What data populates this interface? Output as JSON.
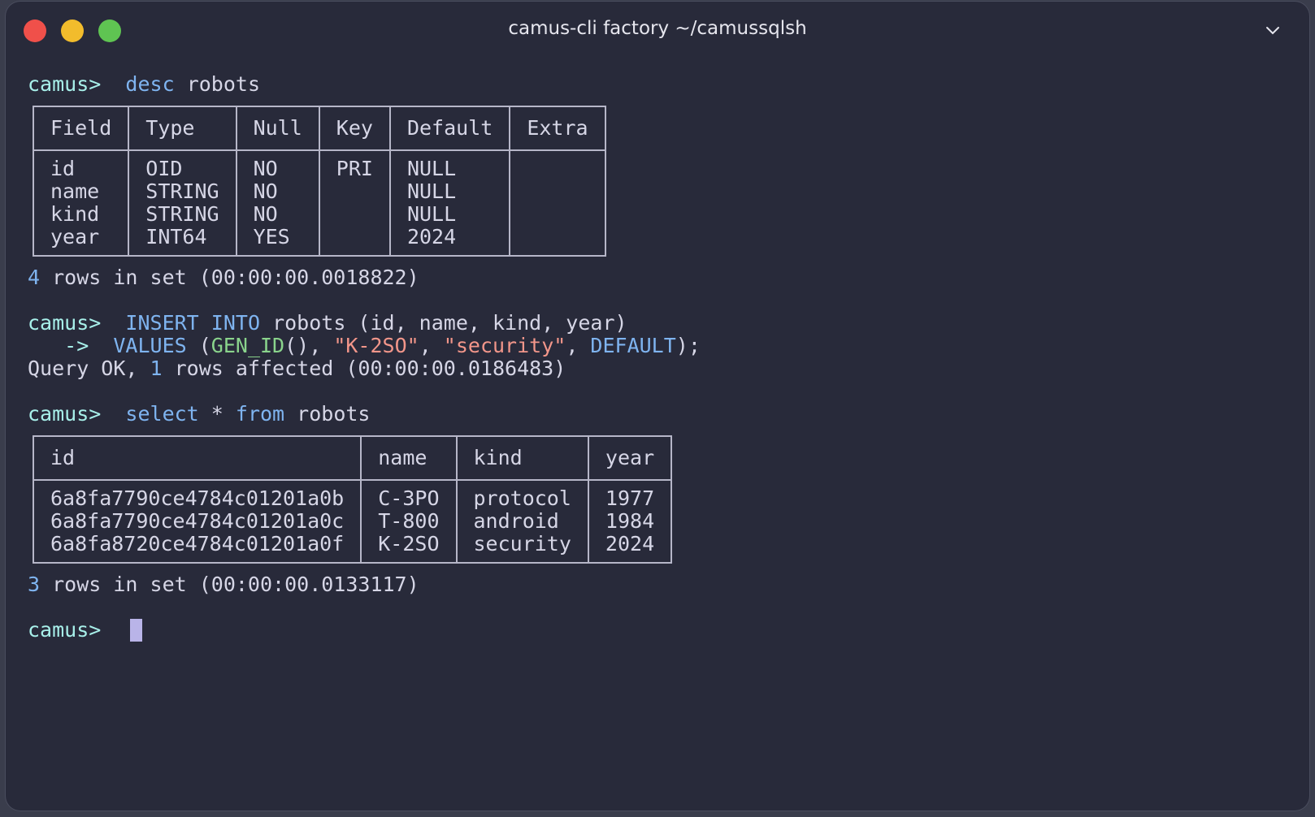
{
  "window": {
    "title": "camus-cli factory ~/camussqlsh"
  },
  "prompt": "camus>",
  "cont_prompt": "   ->",
  "colors": {
    "prompt": "#a8f0ea",
    "keyword": "#7fb4f0",
    "function": "#8ad48c",
    "string": "#f2968a",
    "background": "#282a3a"
  },
  "icons": {
    "close": "close-traffic-light",
    "minimize": "minimize-traffic-light",
    "zoom": "zoom-traffic-light",
    "menu": "chevron-down-icon"
  },
  "cmd1": {
    "kw": "desc",
    "rest": " robots"
  },
  "desc_table": {
    "headers": [
      "Field",
      "Type",
      "Null",
      "Key",
      "Default",
      "Extra"
    ],
    "columns": [
      "id\nname\nkind\nyear",
      "OID\nSTRING\nSTRING\nINT64",
      "NO\nNO\nNO\nYES",
      "PRI",
      "NULL\nNULL\nNULL\n2024",
      ""
    ]
  },
  "result1": {
    "count": "4",
    "text": " rows in set (00:00:00.0018822)"
  },
  "cmd2": {
    "line1": {
      "kw1": "INSERT",
      "sp1": " ",
      "kw2": "INTO",
      "rest": " robots (id, name, kind, year)"
    },
    "line2": {
      "kw": "VALUES",
      "p1": " (",
      "fn": "GEN_ID",
      "p2": "(), ",
      "s1": "\"K-2SO\"",
      "p3": ", ",
      "s2": "\"security\"",
      "p4": ", ",
      "kw2": "DEFAULT",
      "p5": ");"
    }
  },
  "result2": {
    "pre": "Query OK, ",
    "count": "1",
    "text": " rows affected (00:00:00.0186483)"
  },
  "cmd3": {
    "kw1": "select",
    "mid": " * ",
    "kw2": "from",
    "rest": " robots"
  },
  "select_table": {
    "headers": [
      "id",
      "name",
      "kind",
      "year"
    ],
    "columns": [
      "6a8fa7790ce4784c01201a0b\n6a8fa7790ce4784c01201a0c\n6a8fa8720ce4784c01201a0f",
      "C-3PO\nT-800\nK-2SO",
      "protocol\nandroid\nsecurity",
      "1977\n1984\n2024"
    ]
  },
  "result3": {
    "count": "3",
    "text": " rows in set (00:00:00.0133117)"
  }
}
